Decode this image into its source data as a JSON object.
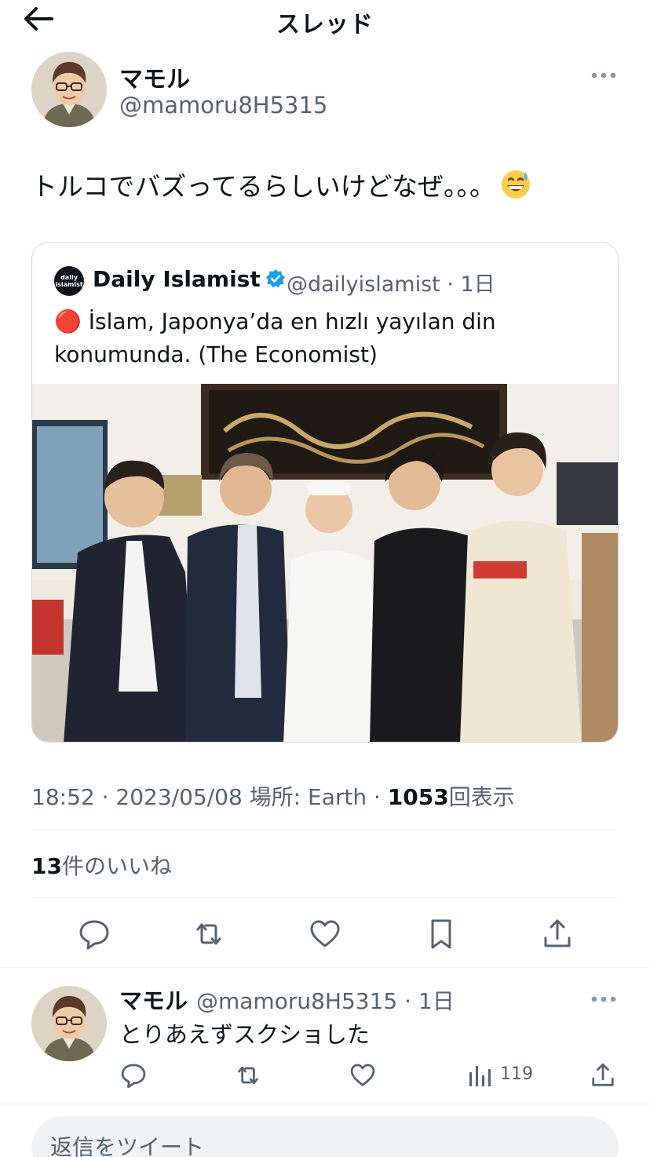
{
  "header": {
    "title": "スレッド",
    "back_icon": "arrow-left-icon"
  },
  "tweet": {
    "author_name": "マモル",
    "author_handle": "@mamoru8H5315",
    "text": "トルコでバズってるらしいけどなぜ。。。",
    "emoji": "grinning-face-with-sweat",
    "quote": {
      "name": "Daily Islamist",
      "handle_time": "@dailyislamist · 1日",
      "avatar_text": "daily islamist",
      "text": "🔴 İslam, Japonya’da en hızlı yayılan din konumunda. (The Economist)"
    },
    "meta": {
      "time": "18:52 · 2023/05/08 場所: Earth · ",
      "views_count": "1053",
      "views_label": "回表示"
    },
    "likes": {
      "count": "13",
      "label": "件のいいね"
    }
  },
  "reply": {
    "author_name": "マモル",
    "handle_time": "@mamoru8H5315 · 1日",
    "text": "とりあえずスクショした",
    "views": "119"
  },
  "compose": {
    "placeholder": "返信をツイート"
  },
  "colors": {
    "text": "#0f1419",
    "secondary": "#536471",
    "border": "#cfd9de",
    "verified": "#1d9bf0"
  }
}
